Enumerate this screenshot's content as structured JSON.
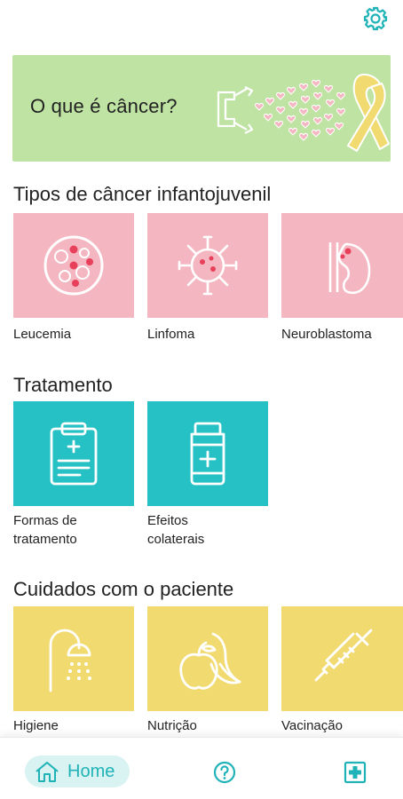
{
  "banner": {
    "title": "O que é câncer?"
  },
  "sections": {
    "tipos": {
      "title": "Tipos de câncer infantojuvenil",
      "items": [
        {
          "label": "Leucemia",
          "icon": "blood-cells-icon"
        },
        {
          "label": "Linfoma",
          "icon": "lymphocyte-icon"
        },
        {
          "label": "Neuroblastoma",
          "icon": "kidney-icon"
        }
      ]
    },
    "tratamento": {
      "title": "Tratamento",
      "items": [
        {
          "label_line1": "Formas de",
          "label_line2": "tratamento",
          "icon": "clipboard-icon"
        },
        {
          "label_line1": "Efeitos",
          "label_line2": "colaterais",
          "icon": "medicine-bottle-icon"
        }
      ]
    },
    "cuidados": {
      "title": "Cuidados com o paciente",
      "items": [
        {
          "label": "Higiene",
          "icon": "shower-icon"
        },
        {
          "label": "Nutrição",
          "icon": "fruits-icon"
        },
        {
          "label": "Vacinação",
          "icon": "syringe-icon"
        }
      ]
    }
  },
  "nav": {
    "home_label": "Home"
  },
  "colors": {
    "pink": "#f4b6c0",
    "teal": "#25c1c4",
    "yellow": "#f1da70",
    "banner": "#bfe3a3",
    "accent": "#1fb3b7"
  }
}
